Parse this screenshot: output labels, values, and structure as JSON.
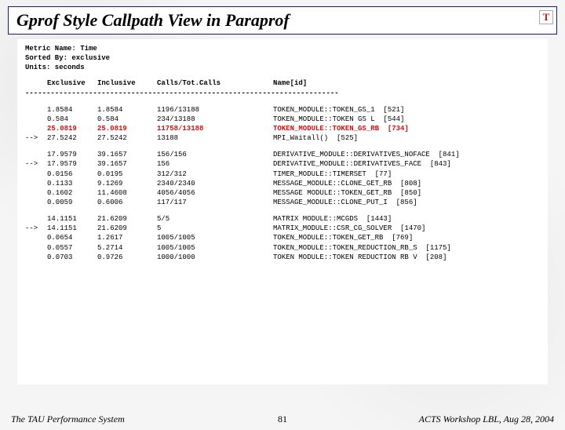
{
  "title": "Gprof Style Callpath View in Paraprof",
  "logo": "T",
  "meta": {
    "metric_line": "Metric Name: Time",
    "sorted_line": "Sorted By: exclusive",
    "units_line": "Units: seconds"
  },
  "columns": {
    "exclusive": "Exclusive",
    "inclusive": "Inclusive",
    "calls": "Calls/Tot.Calls",
    "name": "Name[id]"
  },
  "separator": "--------------------------------------------------------------------------",
  "groups": [
    {
      "rows": [
        {
          "arrow": "",
          "excl": "1.8584",
          "incl": "1.8584",
          "calls": "1196/13188",
          "name": "TOKEN_MODULE::TOKEN_GS_1  [521]",
          "hl": false
        },
        {
          "arrow": "",
          "excl": "0.584",
          "incl": "0.584",
          "calls": "234/13188",
          "name": "TOKEN_MODULE::TOKEN GS L  [544]",
          "hl": false
        },
        {
          "arrow": "",
          "excl": "25.0819",
          "incl": "25.0819",
          "calls": "11758/13188",
          "name": "TOKEN_MODULE::TOKEN_GS_RB  [734]",
          "hl": true
        },
        {
          "arrow": "-->",
          "excl": "27.5242",
          "incl": "27.5242",
          "calls": "13188",
          "name": "MPI_Waitall()  [525]",
          "hl": false
        }
      ]
    },
    {
      "rows": [
        {
          "arrow": "",
          "excl": "17.9579",
          "incl": "39.1657",
          "calls": "156/156",
          "name": "DERIVATIVE_MODULE::DERIVATIVES_NOFACE  [841]",
          "hl": false
        },
        {
          "arrow": "-->",
          "excl": "17.9579",
          "incl": "39.1657",
          "calls": "156",
          "name": "DERIVATIVE_MODULE::DERIVATIVES_FACE  [843]",
          "hl": false
        },
        {
          "arrow": "",
          "excl": "0.0156",
          "incl": "0.0195",
          "calls": "312/312",
          "name": "TIMER_MODULE::TIMERSET  [77]",
          "hl": false
        },
        {
          "arrow": "",
          "excl": "0.1133",
          "incl": "9.1269",
          "calls": "2340/2340",
          "name": "MESSAGE_MODULE::CLONE_GET_RB  [808]",
          "hl": false
        },
        {
          "arrow": "",
          "excl": "0.1602",
          "incl": "11.4608",
          "calls": "4056/4056",
          "name": "MESSAGE MODULE::TOKEN_GET_RB  [850]",
          "hl": false
        },
        {
          "arrow": "",
          "excl": "0.0059",
          "incl": "0.6006",
          "calls": "117/117",
          "name": "MESSAGE_MODULE::CLONE_PUT_I  [856]",
          "hl": false
        }
      ]
    },
    {
      "rows": [
        {
          "arrow": "",
          "excl": "14.1151",
          "incl": "21.6209",
          "calls": "5/5",
          "name": "MATRIX MODULE::MCGDS  [1443]",
          "hl": false
        },
        {
          "arrow": "-->",
          "excl": "14.1151",
          "incl": "21.6209",
          "calls": "5",
          "name": "MATRIX_MODULE::CSR_CG_SOLVER  [1470]",
          "hl": false
        },
        {
          "arrow": "",
          "excl": "0.0654",
          "incl": "1.2617",
          "calls": "1005/1005",
          "name": "TOKEN_MODULE::TOKEN_GET_RB  [769]",
          "hl": false
        },
        {
          "arrow": "",
          "excl": "0.0557",
          "incl": "5.2714",
          "calls": "1005/1005",
          "name": "TOKEN_MODULE::TOKEN_REDUCTION_RB_S  [1175]",
          "hl": false
        },
        {
          "arrow": "",
          "excl": "0.0703",
          "incl": "0.9726",
          "calls": "1000/1000",
          "name": "TOKEN MODULE::TOKEN REDUCTION RB V  [208]",
          "hl": false
        }
      ]
    }
  ],
  "footer": {
    "left": "The TAU Performance System",
    "center": "81",
    "right": "ACTS Workshop LBL, Aug 28, 2004"
  }
}
